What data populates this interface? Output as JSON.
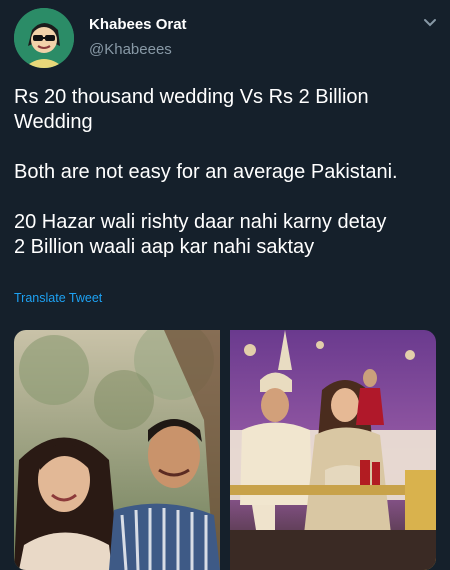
{
  "tweet": {
    "author_name": "Khabees Orat",
    "author_handle": "@Khabeees",
    "text": "Rs 20 thousand wedding Vs Rs 2 Billion\nWedding\n\nBoth are not easy for an average Pakistani.\n\n20 Hazar wali rishty daar nahi karny detay\n2 Billion waali aap kar nahi saktay",
    "translate_label": "Translate Tweet"
  },
  "icons": {
    "menu": "chevron-down-icon",
    "avatar": "avatar"
  },
  "colors": {
    "background": "#15202b",
    "text": "#ffffff",
    "secondary": "#8899a6",
    "link": "#1da1f2"
  }
}
